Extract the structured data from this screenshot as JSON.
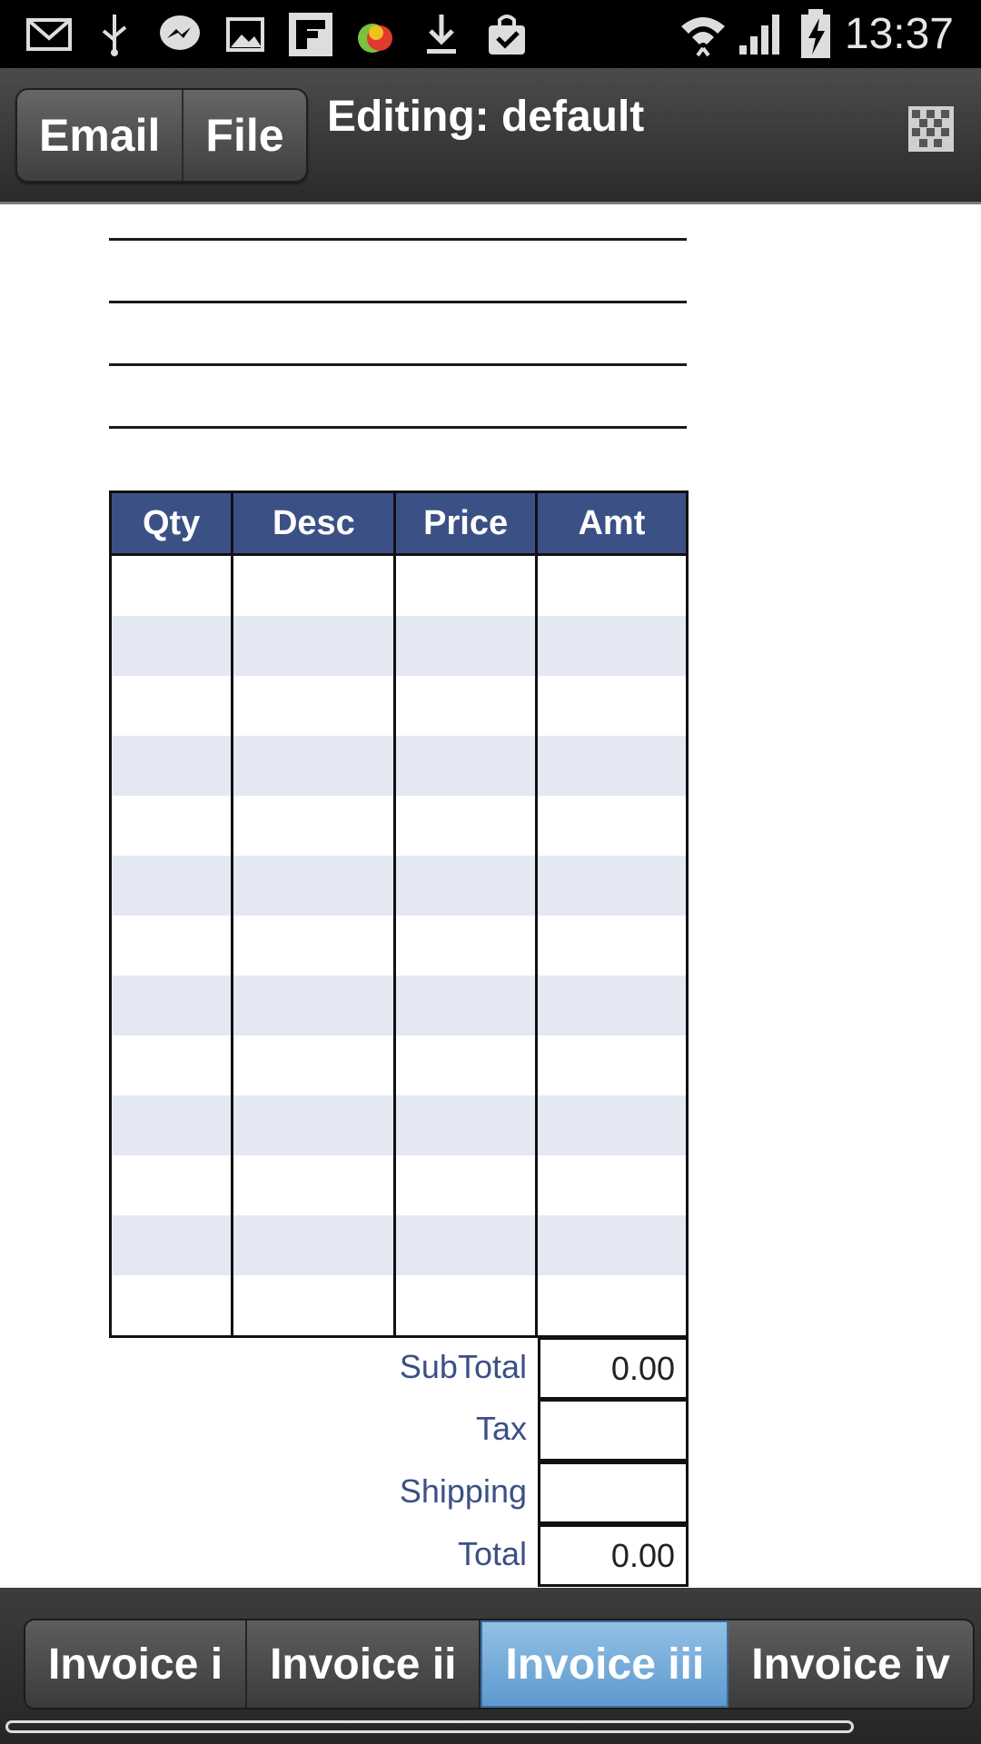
{
  "status_bar": {
    "time": "13:37",
    "icons": [
      "mail-icon",
      "usb-icon",
      "messenger-icon",
      "image-icon",
      "flipboard-icon",
      "fruit-app-icon",
      "download-icon",
      "shopping-bag-icon",
      "wifi-icon",
      "signal-icon",
      "battery-charging-icon"
    ]
  },
  "action_bar": {
    "email_label": "Email",
    "file_label": "File",
    "title": "Editing: default",
    "menu_icon": "grid-icon"
  },
  "table": {
    "headers": [
      "Qty",
      "Desc",
      "Price",
      "Amt"
    ],
    "row_count": 13
  },
  "totals": {
    "subtotal_label": "SubTotal",
    "subtotal_value": "0.00",
    "tax_label": "Tax",
    "tax_value": "",
    "shipping_label": "Shipping",
    "shipping_value": "",
    "total_label": "Total",
    "total_value": "0.00"
  },
  "tabs": {
    "items": [
      "Invoice i",
      "Invoice ii",
      "Invoice iii",
      "Invoice iv"
    ],
    "active": "Invoice iii"
  },
  "colors": {
    "header_blue": "#3b5085",
    "row_stripe": "#e3e8f3",
    "active_tab": "#6fa8d8"
  }
}
